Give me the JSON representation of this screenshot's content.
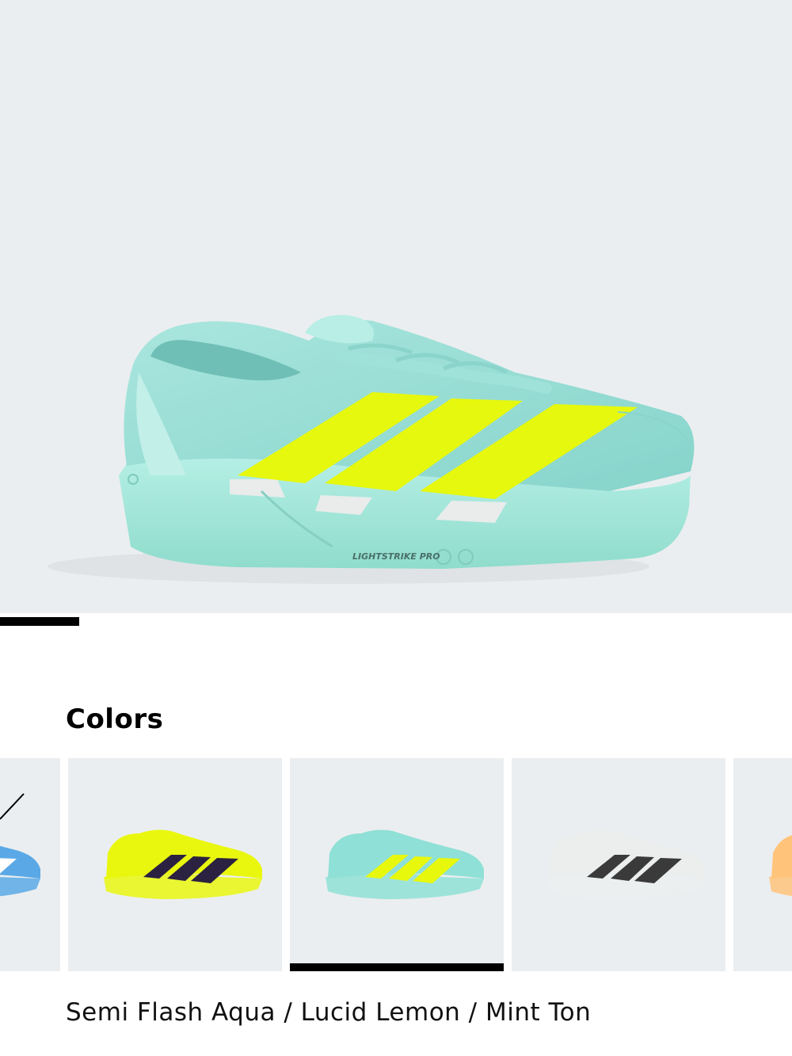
{
  "gallery": {
    "image_alt": "Adizero Adios Pro 4 running shoe",
    "shoe_print_label": "LIGHTSTRIKE PRO",
    "progress_fraction": 0.1
  },
  "colors_section": {
    "title": "Colors",
    "selected_color_name": "Semi Flash Aqua / Lucid Lemon / Mint Ton",
    "swatches": [
      {
        "name": "blue-swatch",
        "base": "#5aa9e6",
        "stripe": "#ffffff"
      },
      {
        "name": "lucid-lemon-swatch",
        "base": "#e9f70f",
        "stripe": "#2b2140"
      },
      {
        "name": "semi-flash-aqua-swatch",
        "base": "#8fe0d6",
        "stripe": "#e8f80c"
      },
      {
        "name": "white-swatch",
        "base": "#eceeee",
        "stripe": "#3a3a3a"
      },
      {
        "name": "orange-swatch",
        "base": "#ffc37a",
        "stripe": "#ffffff"
      }
    ],
    "selected_index": 2
  },
  "palette": {
    "hero_bg": "#ebeef0",
    "upper": "#9fe2da",
    "midsole": "#a8eadf",
    "stripes": "#e6f80d",
    "accent_text": "#000000"
  }
}
